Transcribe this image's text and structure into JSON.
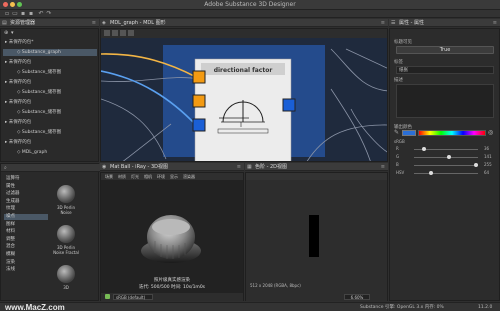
{
  "window": {
    "title": "Adobe Substance 3D Designer"
  },
  "explorer": {
    "title": "资源管理器",
    "items": [
      {
        "label": "未保存的包*",
        "indent": 0
      },
      {
        "label": "Substance_graph",
        "indent": 1,
        "selected": true
      },
      {
        "label": "未保存的包",
        "indent": 0
      },
      {
        "label": "Substance_储存图",
        "indent": 1
      },
      {
        "label": "未保存的包",
        "indent": 0
      },
      {
        "label": "Substance_储存图",
        "indent": 1
      },
      {
        "label": "未保存的包",
        "indent": 0
      },
      {
        "label": "Substance_储存图",
        "indent": 1
      },
      {
        "label": "未保存的包",
        "indent": 0
      },
      {
        "label": "Substance_储存图",
        "indent": 1
      },
      {
        "label": "未保存的包",
        "indent": 0
      },
      {
        "label": "MDL_graph",
        "indent": 1
      }
    ]
  },
  "graph": {
    "title": "MDL_graph - MDL 图形",
    "node_title": "directional factor"
  },
  "properties": {
    "title": "属性 - 属性",
    "section1": "标题可见",
    "true_button": "True",
    "label_label": "标签",
    "label_value": "纸张",
    "desc_label": "描述",
    "color_label": "输出颜色",
    "srgb_label": "sRGB",
    "rows": [
      {
        "name": "R",
        "value": "36"
      },
      {
        "name": "G",
        "value": "141"
      },
      {
        "name": "B",
        "value": "255"
      },
      {
        "name": "HSV",
        "value": "64"
      }
    ]
  },
  "library": {
    "items": [
      "运算符",
      "属性",
      "过滤器",
      "生成器",
      "纹理",
      "噪点",
      "图样",
      "材料",
      "调整",
      "混合",
      "模糊",
      "渲染",
      "法线"
    ],
    "selected_index": 5,
    "nodes": [
      {
        "name": "3D Perlin Noise"
      },
      {
        "name": "3D Perlin Noise Fractal"
      },
      {
        "name": "3D"
      }
    ]
  },
  "viewport3d": {
    "title": "Mat Ball - iRay - 3D视图",
    "menu": [
      "场景",
      "材质",
      "灯光",
      "相机",
      "环境",
      "显示",
      "渲染器"
    ],
    "overlay_line1": "照片级真实感渲染",
    "overlay_line2": "迭代: 500/500   时间: 10s/1m0s",
    "colorspace": "sRGB (default)"
  },
  "viewport2d": {
    "title": "色阶 - 2D视图",
    "info": "512 x 2048 (RGBA, 8bpc)",
    "zoom": "6.60%"
  },
  "status": {
    "watermark": "www.MacZ.com",
    "engine": "Substance 引擎: OpenGL 3.x  内存: 0%",
    "version": "11.2.0"
  },
  "colors": {
    "accent_blue": "#1e5aa8",
    "node_orange": "#f39a12",
    "node_blue": "#1a5fd6",
    "graph_bg": "#274c8c"
  }
}
